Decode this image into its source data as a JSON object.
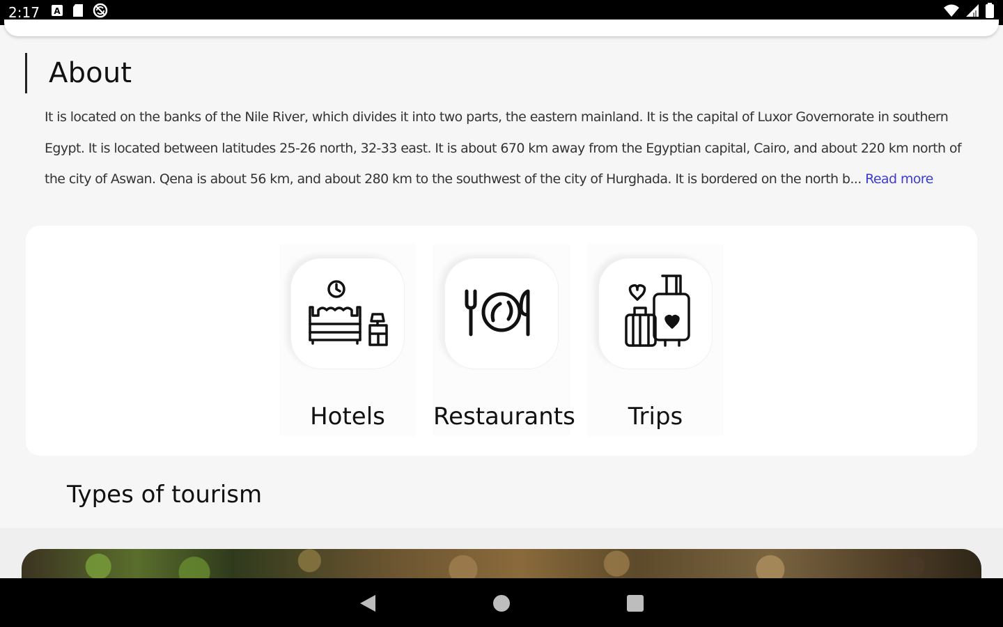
{
  "status_bar": {
    "time": "2:17",
    "left_icons": [
      "notification-a-icon",
      "sd-card-icon",
      "sync-icon"
    ],
    "right_icons": [
      "wifi-icon",
      "cell-signal-icon",
      "battery-icon"
    ]
  },
  "about": {
    "title": "About",
    "text": "It is located on the banks of the Nile River, which divides it into two parts, the eastern mainland. It is the capital of Luxor Governorate in southern Egypt. It is located between latitudes 25-26 north, 32-33 east. It is about 670 km away from the Egyptian capital, Cairo, and about 220 km north of the city of Aswan. Qena is about 56 km, and about 280 km to the southwest of the city of Hurghada. It is bordered on the north b...",
    "read_more": "Read more",
    "read_more_color": "#3b3bd6"
  },
  "categories": [
    {
      "label": "Hotels",
      "icon": "hotel-bed-icon"
    },
    {
      "label": "Restaurants",
      "icon": "restaurant-plate-icon"
    },
    {
      "label": "Trips",
      "icon": "luggage-icon"
    }
  ],
  "types_of_tourism": {
    "title": "Types of tourism"
  },
  "nav_bar": {
    "icons": [
      "back-icon",
      "home-icon",
      "recents-icon"
    ]
  }
}
